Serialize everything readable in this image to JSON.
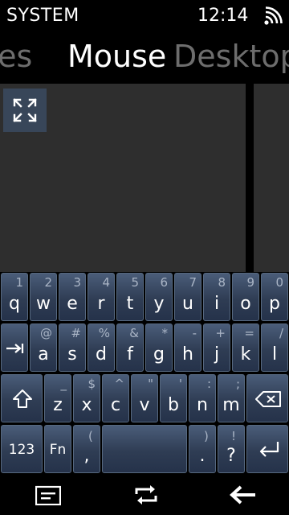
{
  "status": {
    "title": "SYSTEM",
    "time": "12:14"
  },
  "tabs": {
    "prev": "iles",
    "active": "Mouse",
    "next": "Desktop"
  },
  "keyboard": {
    "row1": [
      {
        "main": "q",
        "alt": "1"
      },
      {
        "main": "w",
        "alt": "2"
      },
      {
        "main": "e",
        "alt": "3"
      },
      {
        "main": "r",
        "alt": "4"
      },
      {
        "main": "t",
        "alt": "5"
      },
      {
        "main": "y",
        "alt": "6"
      },
      {
        "main": "u",
        "alt": "7"
      },
      {
        "main": "i",
        "alt": "8"
      },
      {
        "main": "o",
        "alt": "9"
      },
      {
        "main": "p",
        "alt": "0"
      }
    ],
    "row2": [
      {
        "main": "a",
        "alt": "@"
      },
      {
        "main": "s",
        "alt": "#"
      },
      {
        "main": "d",
        "alt": "%"
      },
      {
        "main": "f",
        "alt": "&"
      },
      {
        "main": "g",
        "alt": "*"
      },
      {
        "main": "h",
        "alt": "-"
      },
      {
        "main": "j",
        "alt": "+"
      },
      {
        "main": "k",
        "alt": "="
      },
      {
        "main": "l",
        "alt": "/"
      }
    ],
    "row3": [
      {
        "main": "z",
        "alt": "_"
      },
      {
        "main": "x",
        "alt": "$"
      },
      {
        "main": "c",
        "alt": "^"
      },
      {
        "main": "v",
        "alt": "\""
      },
      {
        "main": "b",
        "alt": "'"
      },
      {
        "main": "n",
        "alt": ":"
      },
      {
        "main": "m",
        "alt": ";"
      }
    ],
    "row4": {
      "numbers_label": "123",
      "fn_label": "Fn",
      "comma": {
        "main": ",",
        "alt": "("
      },
      "period": {
        "main": ".",
        "alt": ")"
      },
      "question": {
        "main": "?",
        "alt": "!"
      }
    }
  }
}
